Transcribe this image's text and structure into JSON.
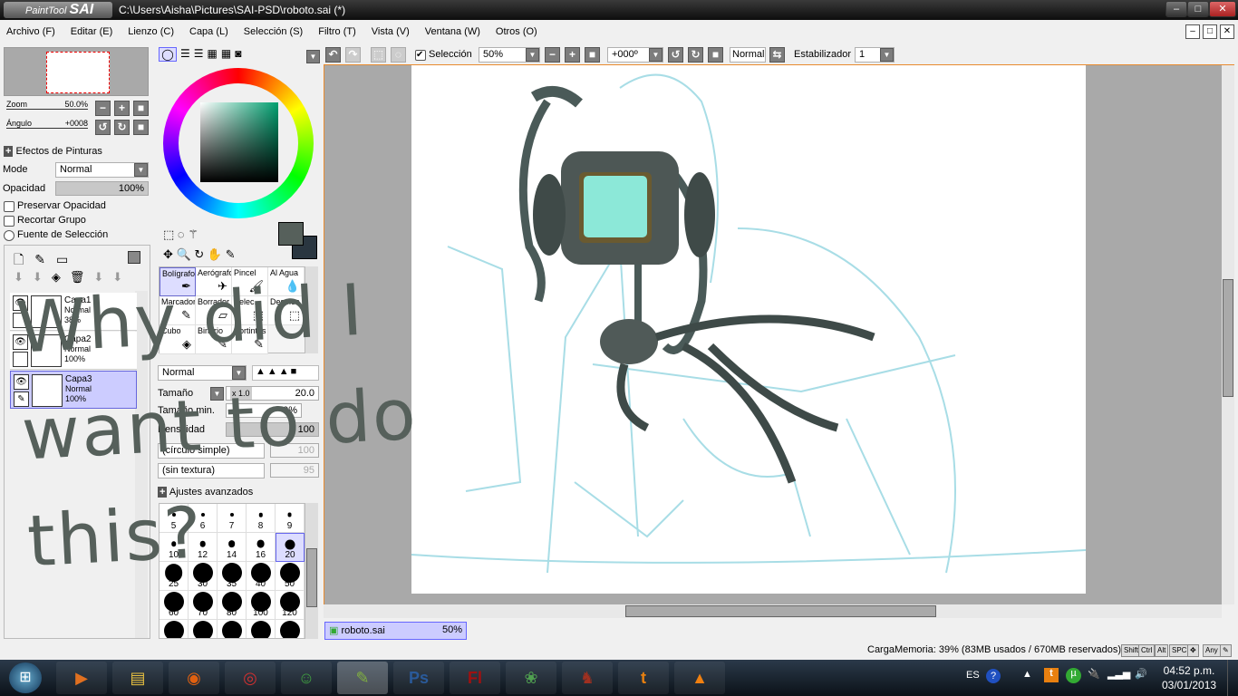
{
  "window": {
    "logo_small": "PaintTool",
    "logo_big": "SAI",
    "title": "C:\\Users\\Aisha\\Pictures\\SAI-PSD\\roboto.sai (*)",
    "min": "–",
    "max": "□",
    "close": "✕"
  },
  "menu": [
    "Archivo (F)",
    "Editar (E)",
    "Lienzo (C)",
    "Capa (L)",
    "Selección (S)",
    "Filtro (T)",
    "Vista (V)",
    "Ventana (W)",
    "Otros (O)"
  ],
  "navigator": {
    "zoom_label": "Zoom",
    "zoom_value": "50.0%",
    "angle_label": "Ángulo",
    "angle_value": "+0008"
  },
  "layer_props": {
    "effects": "Efectos de Pinturas",
    "mode_label": "Mode",
    "mode_value": "Normal",
    "opacity_label": "Opacidad",
    "opacity_value": "100%",
    "opacity_fraction": 1.0,
    "preserve": "Preservar Opacidad",
    "clip": "Recortar Grupo",
    "selsource": "Fuente de Selección"
  },
  "layers": [
    {
      "name": "Capa1",
      "mode": "Normal",
      "opacity": "38%"
    },
    {
      "name": "Capa2",
      "mode": "Normal",
      "opacity": "100%"
    },
    {
      "name": "Capa3",
      "mode": "Normal",
      "opacity": "100%",
      "selected": true
    }
  ],
  "tools": [
    {
      "label": "Bolígrafo",
      "icon": "pen-icon",
      "g": "✒"
    },
    {
      "label": "Aerógrafo",
      "icon": "airbrush-icon",
      "g": "✈"
    },
    {
      "label": "Pincel",
      "icon": "brush-icon",
      "g": "🖌"
    },
    {
      "label": "Al Agua",
      "icon": "water-icon",
      "g": "💧"
    },
    {
      "label": "Marcador",
      "icon": "marker-icon",
      "g": "✎"
    },
    {
      "label": "Borrador",
      "icon": "eraser-icon",
      "g": "▱"
    },
    {
      "label": "Selec.",
      "icon": "select-icon",
      "g": "⬚"
    },
    {
      "label": "Deselec.",
      "icon": "deselect-icon",
      "g": "⬚"
    },
    {
      "label": "Cubo",
      "icon": "bucket-icon",
      "g": "◈"
    },
    {
      "label": "Binario",
      "icon": "binary-icon",
      "g": "✎"
    },
    {
      "label": "Bortintas",
      "icon": "ink-icon",
      "g": "✎"
    }
  ],
  "brush": {
    "blend": "Normal",
    "size_label": "Tamaño",
    "size_mult": "x 1.0",
    "size_value": "20.0",
    "minsize_label": "Tamaño min.",
    "minsize_value": "0%",
    "density_label": "Densitidad",
    "density_value": "100",
    "shape": "(círculo simple)",
    "shape_value": "100",
    "texture": "(sin textura)",
    "texture_value": "95",
    "advanced": "Ajustes avanzados"
  },
  "brush_sizes": [
    "5",
    "6",
    "7",
    "8",
    "9",
    "10",
    "12",
    "14",
    "16",
    "20",
    "25",
    "30",
    "35",
    "40",
    "50",
    "60",
    "70",
    "80",
    "100",
    "120",
    "",
    "",
    "",
    "",
    ""
  ],
  "selected_brush_size": "20",
  "toolbar": {
    "selection_label": "Selección",
    "zoom": "50%",
    "angle": "+000º",
    "blend": "Normal",
    "stabilizer_label": "Estabilizador",
    "stabilizer_value": "1"
  },
  "doc_tab": {
    "name": "roboto.sai",
    "zoom": "50%"
  },
  "status": {
    "memory": "CargaMemoria: 39% (83MB usados / 670MB reservados)",
    "keys": [
      "Shift",
      "Ctrl",
      "Alt",
      "SPC",
      "✥",
      "Any",
      "✎"
    ]
  },
  "canvas_text": "Why did I want to do this?",
  "taskbar": {
    "lang": "ES",
    "time": "04:52 p.m.",
    "date": "03/01/2013",
    "apps": [
      {
        "name": "media-player",
        "g": "▶",
        "c": "#e07020"
      },
      {
        "name": "explorer",
        "g": "▤",
        "c": "#e8c040"
      },
      {
        "name": "firefox",
        "g": "◉",
        "c": "#e06010"
      },
      {
        "name": "chrome",
        "g": "◎",
        "c": "#d03030"
      },
      {
        "name": "messenger",
        "g": "☺",
        "c": "#40a040"
      },
      {
        "name": "paint-tool-sai",
        "g": "✎",
        "c": "#80b040"
      },
      {
        "name": "photoshop",
        "g": "Ps",
        "c": "#2a5a9a"
      },
      {
        "name": "flash",
        "g": "Fl",
        "c": "#a01010"
      },
      {
        "name": "game",
        "g": "❀",
        "c": "#50a050"
      },
      {
        "name": "character",
        "g": "♞",
        "c": "#a03020"
      },
      {
        "name": "tumblr",
        "g": "t",
        "c": "#e88010"
      },
      {
        "name": "vlc",
        "g": "▲",
        "c": "#f08010"
      }
    ]
  },
  "colors": {
    "accent": "#e88a2e",
    "selection": "#ccccff",
    "sketch": "#a8dde6",
    "stroke": "#56605b"
  }
}
